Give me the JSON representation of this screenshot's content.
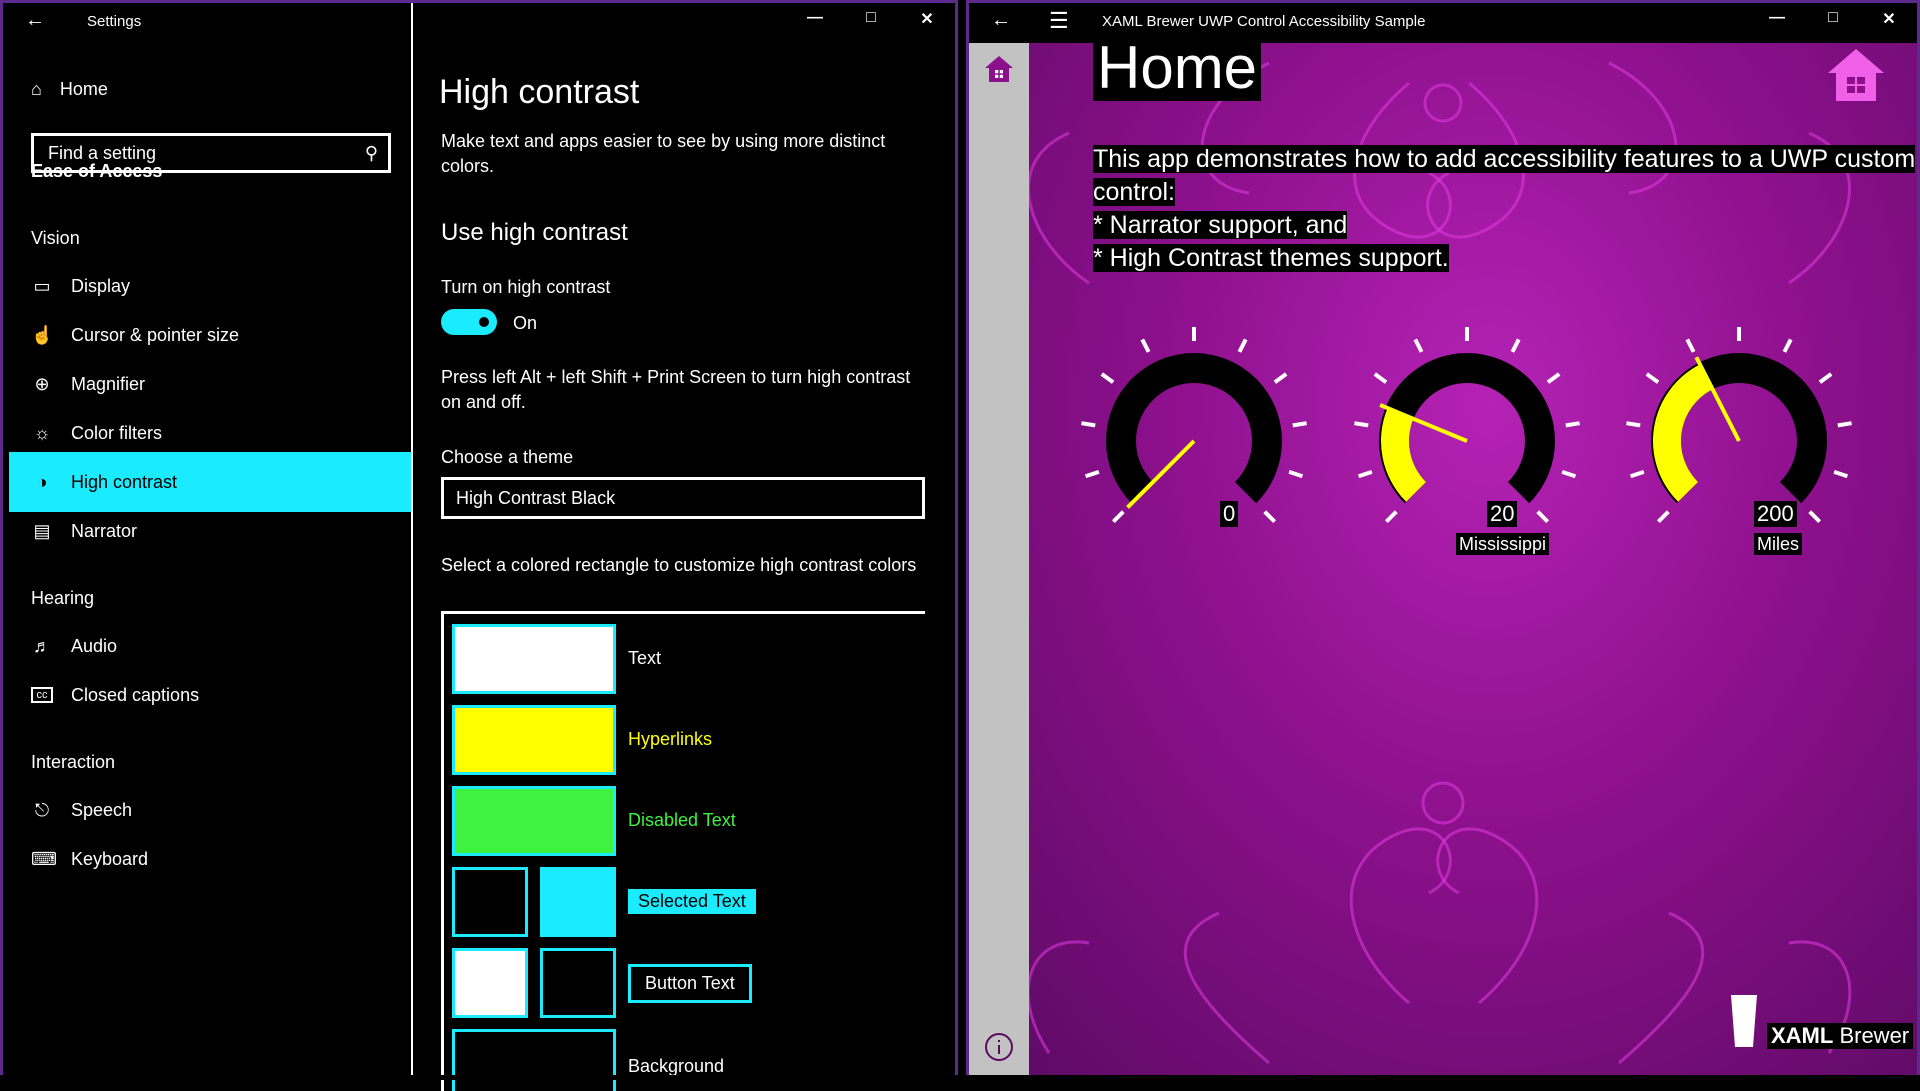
{
  "settings": {
    "title": "Settings",
    "home": "Home",
    "search_placeholder": "Find a setting",
    "category": "Ease of Access",
    "sections": {
      "vision": "Vision",
      "hearing": "Hearing",
      "interaction": "Interaction"
    },
    "nav": {
      "display": "Display",
      "cursor": "Cursor & pointer size",
      "magnifier": "Magnifier",
      "color_filters": "Color filters",
      "high_contrast": "High contrast",
      "narrator": "Narrator",
      "audio": "Audio",
      "captions": "Closed captions",
      "speech": "Speech",
      "keyboard": "Keyboard"
    },
    "page": {
      "heading": "High contrast",
      "description": "Make text and apps easier to see by using more distinct colors.",
      "subheading": "Use high contrast",
      "toggle_label": "Turn on high contrast",
      "toggle_state": "On",
      "shortcut_text": "Press left Alt + left Shift + Print Screen to turn high contrast on and off.",
      "theme_label": "Choose a theme",
      "theme_value": "High Contrast Black",
      "customize_text": "Select a colored rectangle to customize high contrast colors",
      "colors": {
        "text": "Text",
        "hyperlinks": "Hyperlinks",
        "disabled": "Disabled Text",
        "selected": "Selected Text",
        "button": "Button Text",
        "background": "Background"
      }
    },
    "colors": {
      "accent": "#1aebff",
      "hyperlink": "#ffff00",
      "disabled": "#3ff23f",
      "text": "#ffffff",
      "background": "#000000"
    }
  },
  "brewer": {
    "title": "XAML Brewer UWP Control Accessibility Sample",
    "heading": "Home",
    "intro_line1": "This app demonstrates how to add accessibility features to a UWP custom",
    "intro_line2": "control:",
    "bullet1": "* Narrator support, and",
    "bullet2": "* High Contrast themes support.",
    "gauges": [
      {
        "value": "0",
        "unit": "",
        "fraction": 0.0
      },
      {
        "value": "20",
        "unit": "Mississippi",
        "fraction": 0.25
      },
      {
        "value": "200",
        "unit": "Miles",
        "fraction": 0.4
      }
    ],
    "logo_bold": "XAML",
    "logo_rest": " Brewer",
    "colors": {
      "bg": "#8c108c",
      "accent": "#ff00ff",
      "gauge_fill": "#ffff00"
    }
  }
}
